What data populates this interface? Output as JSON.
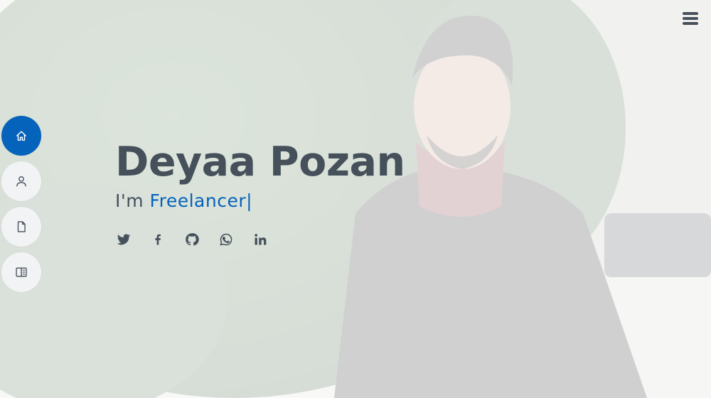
{
  "hero": {
    "name": "Deyaa Pozan",
    "tagline_prefix": "I'm ",
    "typed_text": "Freelancer",
    "typed_cursor": "|"
  },
  "nav": {
    "items": [
      {
        "name": "home",
        "icon": "home-icon",
        "active": true
      },
      {
        "name": "about",
        "icon": "person-icon",
        "active": false
      },
      {
        "name": "resume",
        "icon": "file-icon",
        "active": false
      },
      {
        "name": "portfolio",
        "icon": "book-half-icon",
        "active": false
      }
    ]
  },
  "social": [
    {
      "icon": "twitter-icon"
    },
    {
      "icon": "facebook-icon"
    },
    {
      "icon": "github-icon"
    },
    {
      "icon": "whatsapp-icon"
    },
    {
      "icon": "linkedin-icon"
    }
  ],
  "menu_toggle": {
    "icon": "menu-icon"
  },
  "colors": {
    "accent": "#0563bb",
    "text": "#45505b",
    "nav_bg": "#f2f3f5"
  }
}
